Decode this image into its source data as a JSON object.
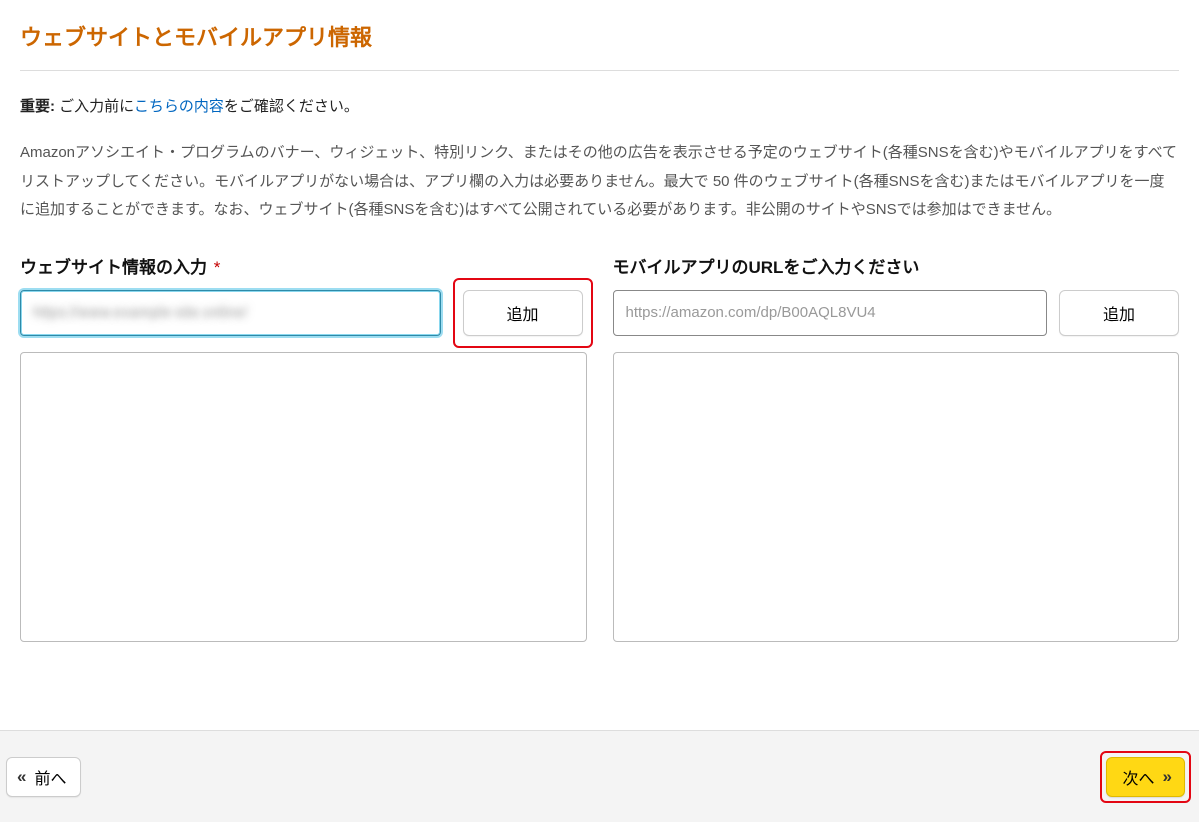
{
  "page": {
    "title": "ウェブサイトとモバイルアプリ情報"
  },
  "notice": {
    "prefix_bold": "重要:",
    "before_link": " ご入力前に",
    "link_text": "こちらの内容",
    "after_link": "をご確認ください。"
  },
  "description": "Amazonアソシエイト・プログラムのバナー、ウィジェット、特別リンク、またはその他の広告を表示させる予定のウェブサイト(各種SNSを含む)やモバイルアプリをすべてリストアップしてください。モバイルアプリがない場合は、アプリ欄の入力は必要ありません。最大で 50 件のウェブサイト(各種SNSを含む)またはモバイルアプリを一度に追加することができます。なお、ウェブサイト(各種SNSを含む)はすべて公開されている必要があります。非公開のサイトやSNSでは参加はできません。",
  "website": {
    "label": "ウェブサイト情報の入力",
    "required_mark": "*",
    "input_value": "https://www.example-site.online/",
    "add_label": "追加"
  },
  "mobile": {
    "label": "モバイルアプリのURLをご入力ください",
    "placeholder": "https://amazon.com/dp/B00AQL8VU4",
    "add_label": "追加"
  },
  "nav": {
    "prev_label": "前へ",
    "next_label": "次へ"
  }
}
